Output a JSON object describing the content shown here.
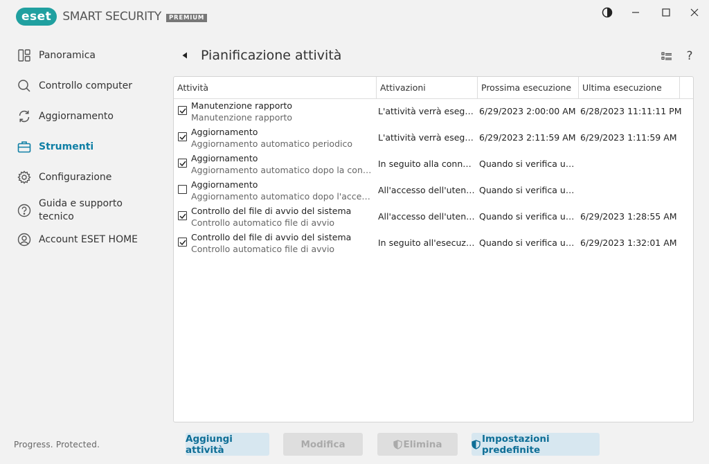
{
  "app": {
    "brand": "eset",
    "name": "SMART SECURITY",
    "edition": "PREMIUM",
    "accent_color": "#0f7fa5",
    "brand_color": "#20a0a0"
  },
  "window_controls": {
    "theme_icon": "contrast-icon",
    "minimize_icon": "minimize-icon",
    "maximize_icon": "maximize-icon",
    "close_icon": "close-icon"
  },
  "sidebar": {
    "items": [
      {
        "label": "Panoramica",
        "icon": "dashboard-icon",
        "active": false
      },
      {
        "label": "Controllo computer",
        "icon": "magnifier-icon",
        "active": false
      },
      {
        "label": "Aggiornamento",
        "icon": "refresh-icon",
        "active": false
      },
      {
        "label": "Strumenti",
        "icon": "briefcase-icon",
        "active": true
      },
      {
        "label": "Configurazione",
        "icon": "gear-icon",
        "active": false
      },
      {
        "label": "Guida e supporto tecnico",
        "icon": "help-circle-icon",
        "active": false
      },
      {
        "label": "Account ESET HOME",
        "icon": "account-icon",
        "active": false
      }
    ],
    "footer": "Progress. Protected."
  },
  "header": {
    "title": "Pianificazione attività"
  },
  "table": {
    "columns": [
      "Attività",
      "Attivazioni",
      "Prossima esecuzione",
      "Ultima esecuzione"
    ],
    "rows": [
      {
        "checked": true,
        "name": "Manutenzione rapporto",
        "desc": "Manutenzione rapporto",
        "trigger": "L'attività verrà eseguit...",
        "next": "6/29/2023 2:00:00 AM",
        "last": "6/28/2023 11:11:11 PM"
      },
      {
        "checked": true,
        "name": "Aggiornamento",
        "desc": "Aggiornamento automatico periodico",
        "trigger": "L'attività verrà eseguit...",
        "next": "6/29/2023 2:11:59 AM",
        "last": "6/29/2023 1:11:59 AM"
      },
      {
        "checked": true,
        "name": "Aggiornamento",
        "desc": "Aggiornamento automatico dopo la conness...",
        "trigger": "In seguito alla conness...",
        "next": "Quando si verifica un ...",
        "last": ""
      },
      {
        "checked": false,
        "name": "Aggiornamento",
        "desc": "Aggiornamento automatico dopo l'accesso ...",
        "trigger": "All'accesso dell'utente ...",
        "next": "Quando si verifica un ...",
        "last": ""
      },
      {
        "checked": true,
        "name": "Controllo del file di avvio del sistema",
        "desc": "Controllo automatico file di avvio",
        "trigger": "All'accesso dell'utente ...",
        "next": "Quando si verifica un ...",
        "last": "6/29/2023 1:28:55 AM"
      },
      {
        "checked": true,
        "name": "Controllo del file di avvio del sistema",
        "desc": "Controllo automatico file di avvio",
        "trigger": "In seguito all'esecuzio...",
        "next": "Quando si verifica un ...",
        "last": "6/29/2023 1:32:01 AM"
      }
    ]
  },
  "actions": {
    "add": "Aggiungi attività",
    "edit": "Modifica",
    "delete": "Elimina",
    "defaults": "Impostazioni predefinite"
  }
}
